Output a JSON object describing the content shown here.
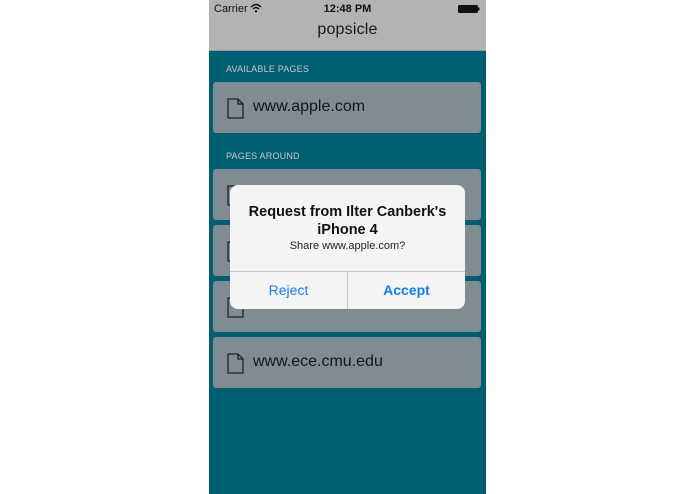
{
  "status_bar": {
    "carrier": "Carrier",
    "time": "12:48 PM",
    "wifi_icon": "wifi-icon",
    "battery_icon": "battery-icon"
  },
  "nav": {
    "title": "popsicle"
  },
  "sections": {
    "available_header": "AVAILABLE PAGES",
    "around_header": "PAGES AROUND"
  },
  "available_pages": [
    {
      "label": "www.apple.com",
      "icon": "document-icon"
    }
  ],
  "pages_around": [
    {
      "label": "",
      "icon": "document-icon"
    },
    {
      "label": "",
      "icon": "document-icon"
    },
    {
      "label": "",
      "icon": "document-icon"
    },
    {
      "label": "www.ece.cmu.edu",
      "icon": "document-icon"
    }
  ],
  "alert": {
    "title": "Request from Ilter Canberk's iPhone 4",
    "message": "Share www.apple.com?",
    "reject_label": "Reject",
    "accept_label": "Accept"
  },
  "colors": {
    "background": "#005e72",
    "row": "#7f8d92",
    "navbar": "#b3b3b3",
    "alert_button": "#1a7cf3"
  }
}
